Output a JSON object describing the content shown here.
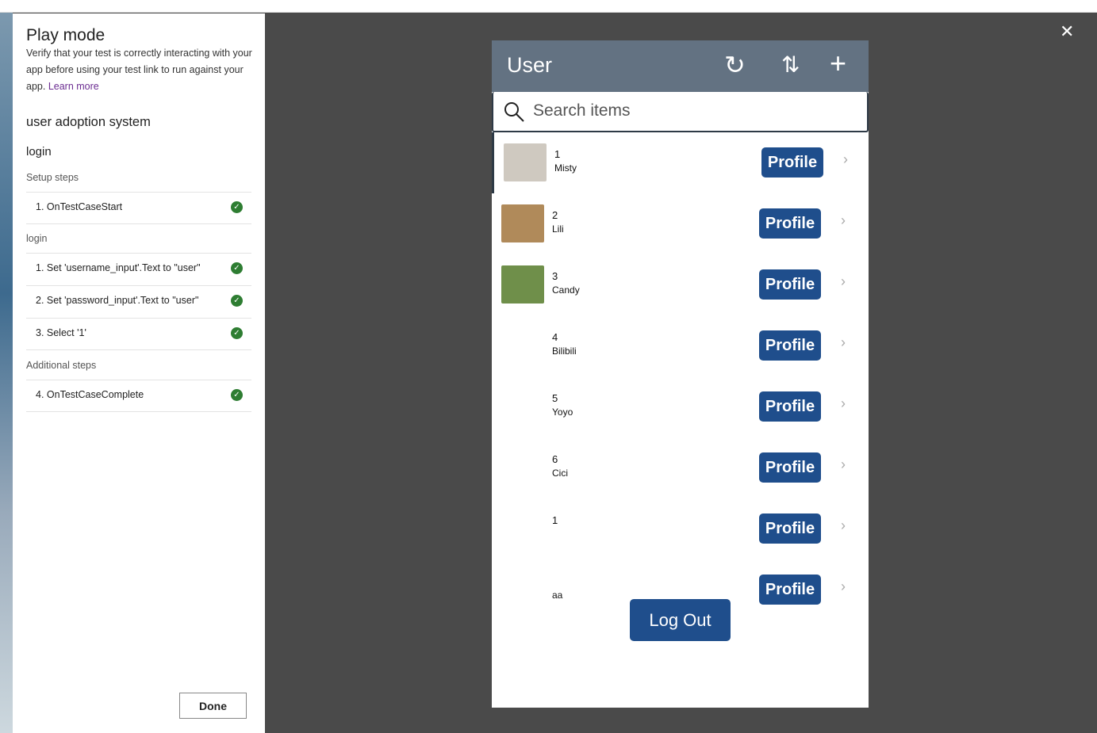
{
  "panel": {
    "title": "Play mode",
    "description": "Verify that your test is correctly interacting with your app before using your test link to run against your app.",
    "learn_more": "Learn more",
    "system": "user adoption system",
    "test_case": "login",
    "setup_label": "Setup steps",
    "setup_steps": [
      "1.  OnTestCaseStart"
    ],
    "login_label": "login",
    "login_steps": [
      "1.  Set 'username_input'.Text to \"user\"",
      "2.  Set 'password_input'.Text to \"user\"",
      "3.  Select '1'"
    ],
    "additional_label": "Additional steps",
    "additional_steps": [
      "4.  OnTestCaseComplete"
    ],
    "done": "Done"
  },
  "app": {
    "title": "User",
    "search_placeholder": "Search items",
    "profile_label": "Profile",
    "logout": "Log Out",
    "items": [
      {
        "num": "1",
        "name": "Misty",
        "pic": "#cfc9c0"
      },
      {
        "num": "2",
        "name": "Lili",
        "pic": "#b08a5a"
      },
      {
        "num": "3",
        "name": "Candy",
        "pic": "#6f8f4a"
      },
      {
        "num": "4",
        "name": "Bilibili"
      },
      {
        "num": "5",
        "name": "Yoyo"
      },
      {
        "num": "6",
        "name": "Cici"
      },
      {
        "num": "1",
        "name": ""
      },
      {
        "num": "",
        "name": "aa"
      }
    ]
  }
}
